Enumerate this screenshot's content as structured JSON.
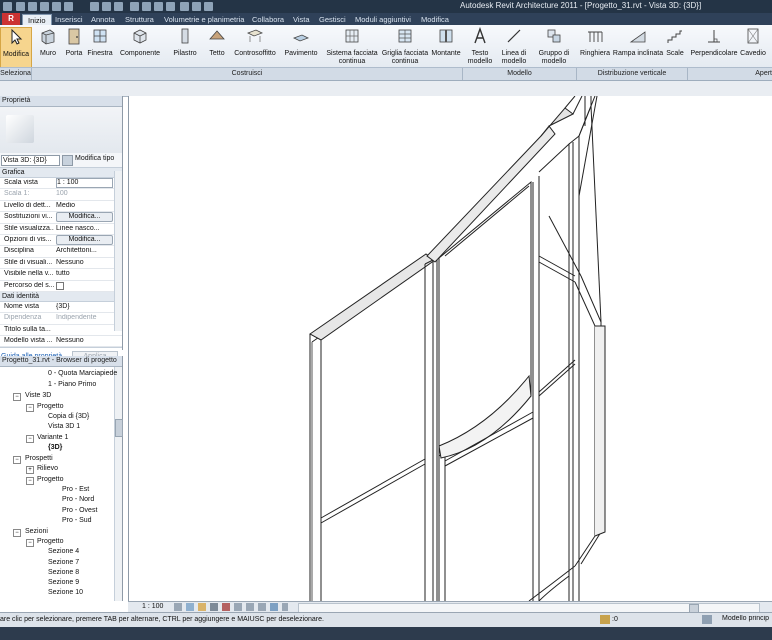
{
  "window": {
    "title": "Autodesk Revit Architecture 2011 - [Progetto_31.rvt - Vista 3D: {3D}]",
    "app_button": "R"
  },
  "tabs": [
    "Inizio",
    "Inserisci",
    "Annota",
    "Struttura",
    "Volumetrie e planimetria",
    "Collabora",
    "Vista",
    "Gestisci",
    "Moduli aggiuntivi",
    "Modifica"
  ],
  "active_tab": "Inizio",
  "ribbon": {
    "buttons": [
      {
        "label": "Modifica",
        "icon": "cursor-arrow-icon"
      },
      {
        "label": "Muro",
        "icon": "wall-icon"
      },
      {
        "label": "Porta",
        "icon": "door-icon"
      },
      {
        "label": "Finestra",
        "icon": "window-icon"
      },
      {
        "label": "Componente",
        "icon": "component-icon"
      },
      {
        "label": "Pilastro",
        "icon": "column-icon"
      },
      {
        "label": "Tetto",
        "icon": "roof-icon"
      },
      {
        "label": "Controsoffitto",
        "icon": "ceiling-icon"
      },
      {
        "label": "Pavimento",
        "icon": "floor-icon"
      },
      {
        "label": "Sistema facciata continua",
        "icon": "curtain-system-icon"
      },
      {
        "label": "Griglia facciata continua",
        "icon": "curtain-grid-icon"
      },
      {
        "label": "Montante",
        "icon": "mullion-icon"
      },
      {
        "label": "Testo modello",
        "icon": "model-text-icon"
      },
      {
        "label": "Linea di modello",
        "icon": "model-line-icon"
      },
      {
        "label": "Gruppo di modello",
        "icon": "model-group-icon"
      },
      {
        "label": "Ringhiera",
        "icon": "railing-icon"
      },
      {
        "label": "Rampa inclinata",
        "icon": "ramp-icon"
      },
      {
        "label": "Scale",
        "icon": "stair-icon"
      },
      {
        "label": "Perpendicolare",
        "icon": "perpendicular-icon"
      },
      {
        "label": "Cavedio",
        "icon": "shaft-icon"
      }
    ],
    "groups": [
      "Seleziona",
      "Costruisci",
      "Modello",
      "Distribuzione verticale",
      "Apert"
    ]
  },
  "properties": {
    "title": "Proprietà",
    "type_selector": "Vista 3D: {3D}",
    "edit_type": "Modifica tipo",
    "categories": {
      "grafica": "Grafica",
      "dati_identita": "Dati identità"
    },
    "grafica_rows": [
      {
        "name": "Scala vista",
        "value": "1 : 100"
      },
      {
        "name": "Scala 1:",
        "value": "100"
      },
      {
        "name": "Livello di dett...",
        "value": "Medio"
      },
      {
        "name": "Sostituzioni vi...",
        "value": "Modifica..."
      },
      {
        "name": "Stile visualizza...",
        "value": "Linee nasco..."
      },
      {
        "name": "Opzioni di vis...",
        "value": "Modifica..."
      },
      {
        "name": "Disciplina",
        "value": "Architettoni..."
      },
      {
        "name": "Stile di visuali...",
        "value": "Nessuno"
      },
      {
        "name": "Visibile nella v...",
        "value": "tutto"
      },
      {
        "name": "Percorso del s...",
        "value": ""
      }
    ],
    "identity_rows": [
      {
        "name": "Nome vista",
        "value": "{3D}"
      },
      {
        "name": "Dipendenza",
        "value": "Indipendente"
      },
      {
        "name": "Titolo sulla ta...",
        "value": ""
      },
      {
        "name": "Modello vista ...",
        "value": "Nessuno"
      }
    ],
    "help_link": "Guida alle proprietà",
    "apply": "Applica"
  },
  "browser": {
    "title": "Progetto_31.rvt - Browser di progetto",
    "nodes": [
      "0 - Quota Marciapiede",
      "1 - Piano Primo",
      "Viste 3D",
      "Progetto",
      "Copia di {3D}",
      "Vista 3D 1",
      "Variante 1",
      "{3D}",
      "Prospetti",
      "Rilievo",
      "Progetto",
      "Pro - Est",
      "Pro - Nord",
      "Pro - Ovest",
      "Pro - Sud",
      "Sezioni",
      "Progetto",
      "Sezione 4",
      "Sezione 7",
      "Sezione 8",
      "Sezione 9",
      "Sezione 10"
    ]
  },
  "view_control": {
    "scale": "1 : 100"
  },
  "status": {
    "message": "are clic per selezionare, premere TAB per alternare, CTRL per aggiungere e MAIUSC per deselezionare.",
    "model": "Modello princip"
  }
}
